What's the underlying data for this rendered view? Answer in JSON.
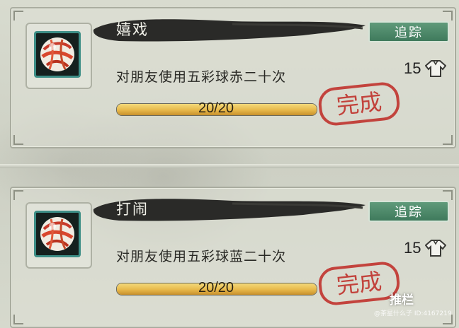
{
  "quests": [
    {
      "title": "嬉戏",
      "track_label": "追踪",
      "description": "对朋友使用五彩球赤二十次",
      "progress_text": "20/20",
      "progress": 1.0,
      "reward_amount": "15",
      "reward_icon": "clothing-reward-icon",
      "stamp_text": "完成",
      "item_icon": "colorful-ball-icon"
    },
    {
      "title": "打闹",
      "track_label": "追踪",
      "description": "对朋友使用五彩球蓝二十次",
      "progress_text": "20/20",
      "progress": 1.0,
      "reward_amount": "15",
      "reward_icon": "clothing-reward-icon",
      "stamp_text": "完成",
      "item_icon": "colorful-ball-icon"
    }
  ],
  "watermark": {
    "brand": "推栏",
    "sub": "@茶星什么子 ID:4167219"
  },
  "colors": {
    "track_button": "#4f8a6c",
    "progress_fill": "#e7b84a",
    "stamp_red": "#c0322c",
    "icon_border": "#3d8e86"
  }
}
